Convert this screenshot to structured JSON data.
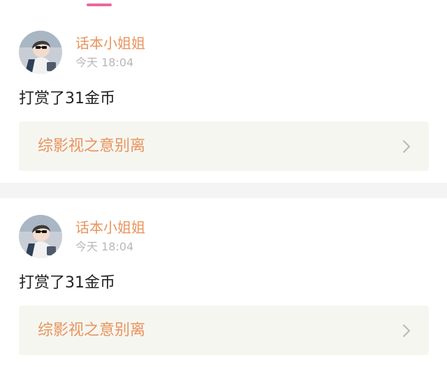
{
  "accent": "#e86aa0",
  "name_color": "#e8945d",
  "posts": [
    {
      "username": "话本小姐姐",
      "time": "今天 18:04",
      "message": "打赏了31金币",
      "book_title": "综影视之意别离",
      "avatar_icon": "user-avatar",
      "chevron_icon": "chevron-right-icon"
    },
    {
      "username": "话本小姐姐",
      "time": "今天 18:04",
      "message": "打赏了31金币",
      "book_title": "综影视之意别离",
      "avatar_icon": "user-avatar",
      "chevron_icon": "chevron-right-icon"
    }
  ]
}
